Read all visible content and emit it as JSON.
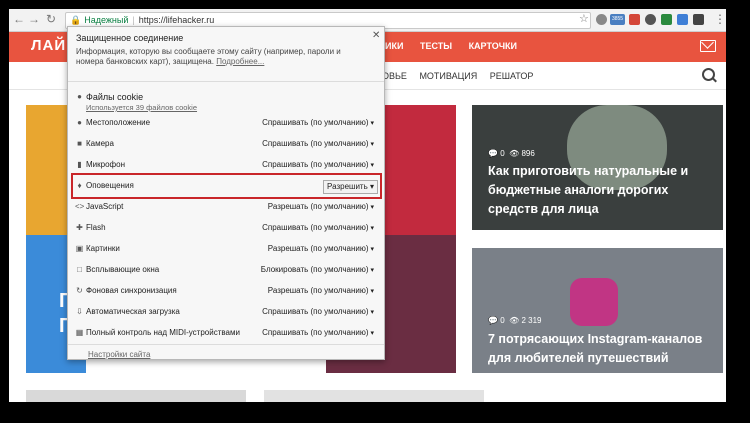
{
  "browser": {
    "secure_label": "Надежный",
    "url": "https://lifehacker.ru",
    "ext_badge": "3855"
  },
  "site": {
    "logo": "ЛАЙ",
    "topnav": [
      "РИКИ",
      "ТЕСТЫ",
      "КАРТОЧКИ"
    ],
    "subnav": [
      "ОВЬЕ",
      "МОТИВАЦИЯ",
      "РЕШАТОР"
    ],
    "left_letter_1": "Г",
    "left_letter_2": "Г"
  },
  "cards": [
    {
      "comments": "0",
      "views": "896",
      "title_line1": "Как приготовить натуральные и",
      "title_line2": "бюджетные аналоги дорогих",
      "title_line3": "средств для лица"
    },
    {
      "comments": "0",
      "views": "2 319",
      "title_line1": "7 потрясающих Instagram-каналов",
      "title_line2": "для любителей путешествий"
    }
  ],
  "popup": {
    "title": "Защищенное соединение",
    "description": "Информация, которую вы сообщаете этому сайту (например, пароли и номера банковских карт), защищена.",
    "more_link": "Подробнее...",
    "cookies_label": "Файлы cookie",
    "cookies_sub": "Используется 39 файлов cookie",
    "permissions": [
      {
        "label": "Местоположение",
        "value": "Спрашивать (по умолчанию)",
        "icon": "location-icon"
      },
      {
        "label": "Камера",
        "value": "Спрашивать (по умолчанию)",
        "icon": "camera-icon"
      },
      {
        "label": "Микрофон",
        "value": "Спрашивать (по умолчанию)",
        "icon": "microphone-icon"
      },
      {
        "label": "Оповещения",
        "value": "Разрешить",
        "icon": "bell-icon"
      },
      {
        "label": "JavaScript",
        "value": "Разрешать (по умолчанию)",
        "icon": "code-icon"
      },
      {
        "label": "Flash",
        "value": "Спрашивать (по умолчанию)",
        "icon": "puzzle-icon"
      },
      {
        "label": "Картинки",
        "value": "Разрешать (по умолчанию)",
        "icon": "image-icon"
      },
      {
        "label": "Всплывающие окна",
        "value": "Блокировать (по умолчанию)",
        "icon": "popup-icon"
      },
      {
        "label": "Фоновая синхронизация",
        "value": "Разрешать (по умолчанию)",
        "icon": "sync-icon"
      },
      {
        "label": "Автоматическая загрузка",
        "value": "Спрашивать (по умолчанию)",
        "icon": "download-icon"
      },
      {
        "label": "Полный контроль над MIDI-устройствами",
        "value": "Спрашивать (по умолчанию)",
        "icon": "midi-icon"
      }
    ],
    "site_settings_link": "Настройки сайта"
  }
}
